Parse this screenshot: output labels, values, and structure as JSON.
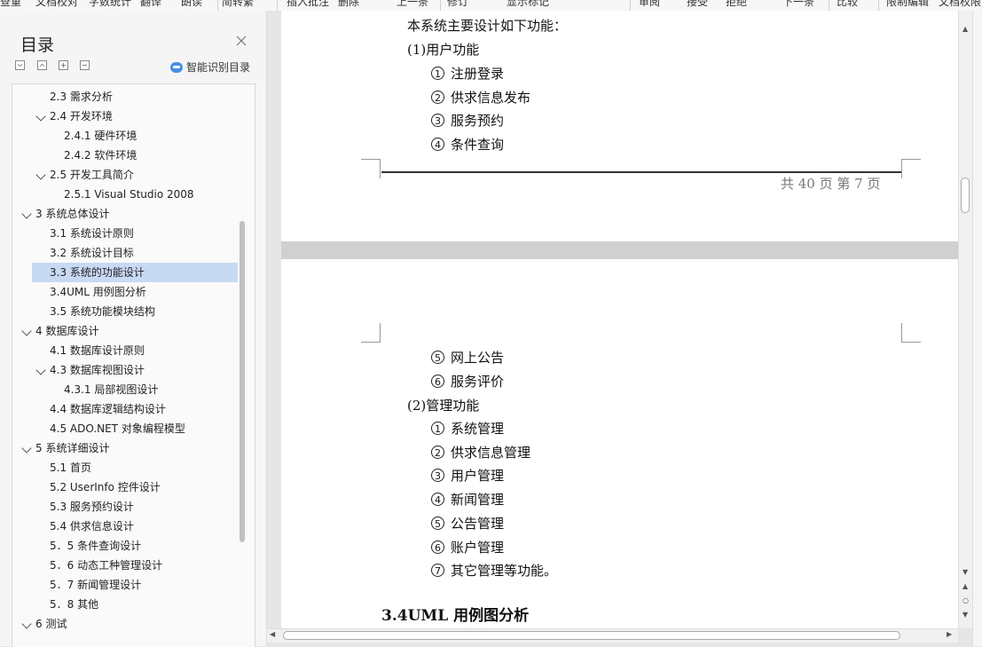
{
  "toolbar": {
    "items": [
      "查重",
      "文档校对",
      "字数统计",
      "翻译",
      "朗读",
      "简转繁",
      "插入批注",
      "删除",
      "上一条",
      "修订",
      "显示标记",
      "审阅",
      "接受",
      "拒绝",
      "下一条",
      "比较",
      "限制编辑",
      "文档权限"
    ]
  },
  "nav": {
    "title": "目录",
    "smart_label": "智能识别目录",
    "items": [
      {
        "label": "2.3  需求分析"
      },
      {
        "label": "2.4  开发环境"
      },
      {
        "label": "2.4.1 硬件环境"
      },
      {
        "label": "2.4.2 软件环境"
      },
      {
        "label": "2.5 开发工具简介"
      },
      {
        "label": "2.5.1 Visual Studio 2008"
      },
      {
        "label": "3 系统总体设计"
      },
      {
        "label": "3.1 系统设计原则"
      },
      {
        "label": "3.2 系统设计目标"
      },
      {
        "label": "3.3 系统的功能设计"
      },
      {
        "label": "3.4UML 用例图分析"
      },
      {
        "label": "3.5 系统功能模块结构"
      },
      {
        "label": "4 数据库设计"
      },
      {
        "label": "4.1 数据库设计原则"
      },
      {
        "label": "4.3 数据库视图设计"
      },
      {
        "label": "4.3.1 局部视图设计"
      },
      {
        "label": "4.4 数据库逻辑结构设计"
      },
      {
        "label": "4.5 ADO.NET  对象编程模型"
      },
      {
        "label": "5 系统详细设计"
      },
      {
        "label": "5.1 首页"
      },
      {
        "label": "5.2 UserInfo 控件设计"
      },
      {
        "label": "5.3  服务预约设计"
      },
      {
        "label": "5.4 供求信息设计"
      },
      {
        "label": "5．5 条件查询设计"
      },
      {
        "label": "5．6 动态工种管理设计"
      },
      {
        "label": "5．7 新闻管理设计"
      },
      {
        "label": "5．8  其他"
      },
      {
        "label": "6 测试"
      }
    ]
  },
  "doc": {
    "page1": {
      "intro": "本系统主要设计如下功能：",
      "section1": "(1)用户功能",
      "items": [
        {
          "num": "1",
          "text": "注册登录"
        },
        {
          "num": "2",
          "text": "供求信息发布"
        },
        {
          "num": "3",
          "text": "服务预约"
        },
        {
          "num": "4",
          "text": "条件查询"
        }
      ],
      "footer": "共 40 页   第  7  页"
    },
    "page2": {
      "items_a": [
        {
          "num": "5",
          "text": "网上公告"
        },
        {
          "num": "6",
          "text": "服务评价"
        }
      ],
      "section2": "(2)管理功能",
      "items_b": [
        {
          "num": "1",
          "text": "系统管理"
        },
        {
          "num": "2",
          "text": "供求信息管理"
        },
        {
          "num": "3",
          "text": "用户管理"
        },
        {
          "num": "4",
          "text": "新闻管理"
        },
        {
          "num": "5",
          "text": "公告管理"
        },
        {
          "num": "6",
          "text": "账户管理"
        },
        {
          "num": "7",
          "text": "其它管理等功能。"
        }
      ],
      "heading": "3.4UML 用例图分析"
    }
  },
  "colors": {
    "selected_row": "#c8d9f4",
    "accent": "#4a90e2"
  }
}
